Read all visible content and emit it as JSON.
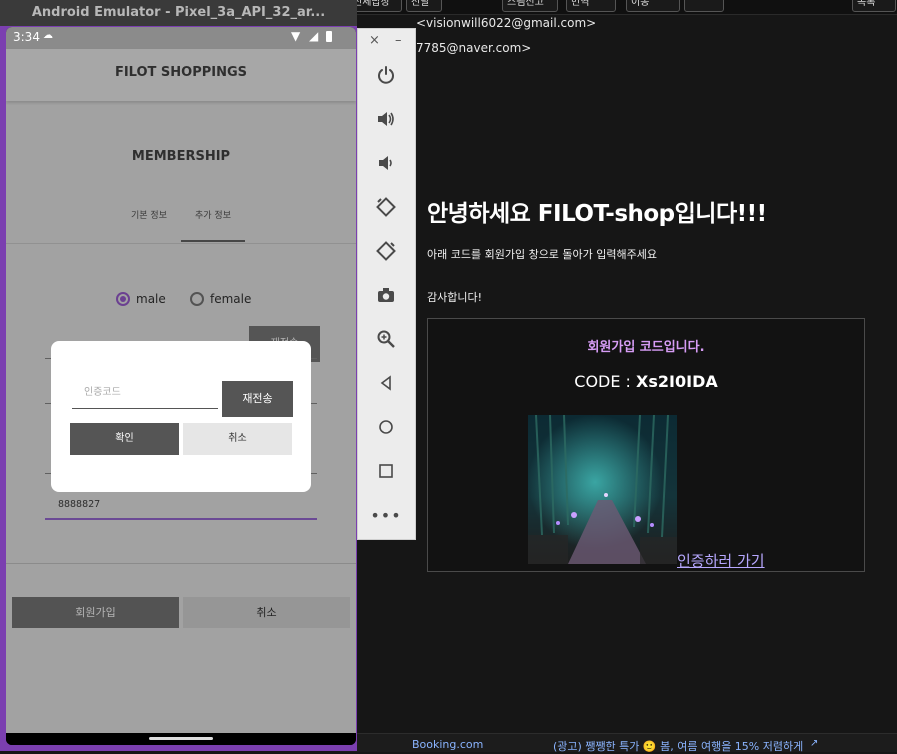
{
  "mail": {
    "top_buttons": [
      "전체답장",
      "전달",
      "스팸신고",
      "번역",
      "이동",
      "",
      "",
      "목록"
    ],
    "to_address": "<visionwill6022@gmail.com>",
    "cc_address": "7785@naver.com>",
    "heading": "안녕하세요 FILOT-shop입니다!!!",
    "line1": "아래 코드를 회원가입 창으로 돌아가 입력해주세요",
    "line2": "감사합니다!",
    "code_title": "회원가입 코드입니다.",
    "code_label": "CODE : ",
    "code_value": "Xs2I0IDA",
    "verify_link": "인증하러 가기",
    "footer_left": "Booking.com",
    "footer_right": "(광고) 쨍쨍한 특가 🙂 봄, 여름 여행을 15% 저렴하게"
  },
  "emulator": {
    "title": "Android Emulator - Pixel_3a_API_32_ar...",
    "side_tools": [
      "power-icon",
      "volume-up-icon",
      "volume-down-icon",
      "rotate-left-icon",
      "rotate-right-icon",
      "camera-icon",
      "zoom-icon",
      "back-icon",
      "home-icon",
      "overview-icon",
      "more-icon"
    ]
  },
  "phone": {
    "time": "3:34",
    "app_title": "FILOT SHOPPINGS",
    "section_title": "MEMBERSHIP",
    "tabs": [
      "기본 정보",
      "추가 정보"
    ],
    "gender_options": [
      "male",
      "female"
    ],
    "selected_gender": "male",
    "bg_button": "재전송",
    "phone_value": "8888827",
    "signup_button": "회원가입",
    "cancel_button": "취소"
  },
  "dialog": {
    "input_placeholder": "인증코드",
    "resend_button": "재전송",
    "confirm_button": "확인",
    "cancel_button": "취소"
  }
}
